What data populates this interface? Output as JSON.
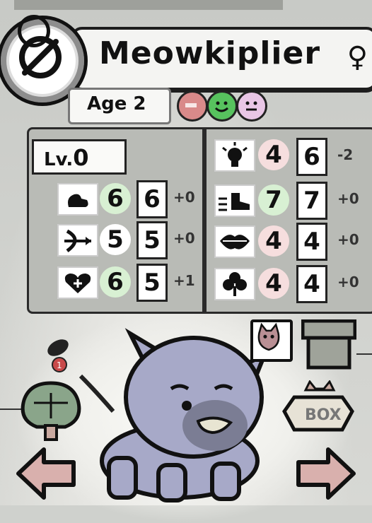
{
  "cat": {
    "name": "Meowkiplier",
    "gender_symbol": "♀",
    "age_label": "Age 2",
    "level_prefix": "Lv.",
    "level": "0"
  },
  "moods": [
    {
      "name": "heart-mood",
      "color": "#d98a8a"
    },
    {
      "name": "happy-mood",
      "color": "#57c25e"
    },
    {
      "name": "neutral-mood",
      "color": "#e9c6e6"
    }
  ],
  "stats_left": [
    {
      "icon": "strength-icon",
      "base": "6",
      "total": "6",
      "mod": "+0",
      "base_color": "#d8f0d3"
    },
    {
      "icon": "dexterity-icon",
      "base": "5",
      "total": "5",
      "mod": "+0",
      "base_color": "#ffffff"
    },
    {
      "icon": "constitution-icon",
      "base": "6",
      "total": "5",
      "mod": "+1",
      "base_color": "#d8f0d3"
    }
  ],
  "stats_right": [
    {
      "icon": "intelligence-icon",
      "base": "4",
      "total": "6",
      "mod": "-2",
      "base_color": "#f6dede"
    },
    {
      "icon": "speed-icon",
      "base": "7",
      "total": "7",
      "mod": "+0",
      "base_color": "#d8f0d3"
    },
    {
      "icon": "charisma-icon",
      "base": "4",
      "total": "4",
      "mod": "+0",
      "base_color": "#f6dede"
    },
    {
      "icon": "luck-icon",
      "base": "4",
      "total": "4",
      "mod": "+0",
      "base_color": "#f6dede"
    }
  ],
  "buttons": {
    "box_label": "BOX",
    "candy_badge": "1"
  },
  "colors": {
    "panel": "#b9bbb6",
    "arrow": "#d9b0ad",
    "pipe": "#9fa39a",
    "tree": "#8aa58a"
  }
}
